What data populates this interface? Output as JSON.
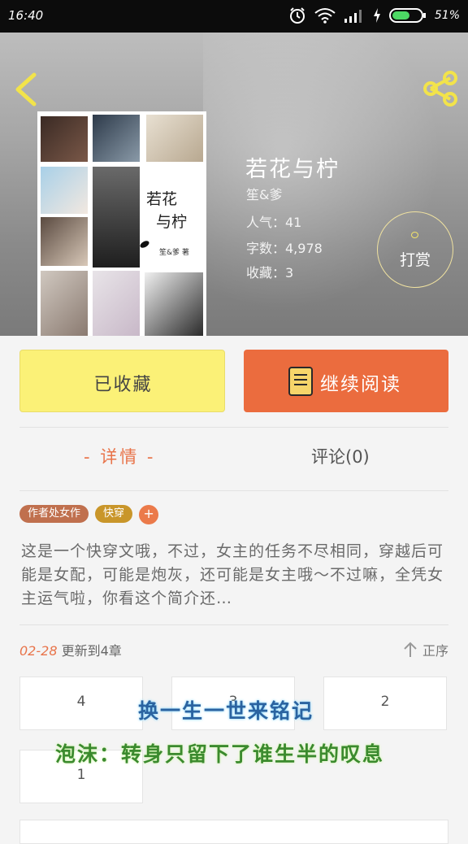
{
  "status_bar": {
    "time": "16:40",
    "battery_percent": "51%",
    "icons": [
      "alarm-icon",
      "wifi-icon",
      "signal-icon",
      "charging-icon",
      "battery-icon"
    ]
  },
  "header": {
    "back_icon": "chevron-left-icon",
    "share_icon": "share-icon"
  },
  "cover": {
    "title_line1": "若花",
    "title_line2": "与柠",
    "author": "笙&爹 著"
  },
  "book": {
    "title": "若花与柠",
    "author": "笙&爹",
    "popularity": "人气：41",
    "word_count": "字数：4,978",
    "favorites": "收藏：3"
  },
  "reward": {
    "label": "打赏"
  },
  "actions": {
    "favorited_label": "已收藏",
    "continue_label": "继续阅读",
    "continue_icon": "book-icon"
  },
  "tabs": {
    "details": "- 详情 -",
    "comments": "评论(0)"
  },
  "tags": [
    {
      "label": "作者处女作",
      "color": "#c0704e"
    },
    {
      "label": "快穿",
      "color": "#c9962a"
    }
  ],
  "tag_add_label": "+",
  "intro": "这是一个快穿文哦，不过，女主的任务不尽相同，穿越后可能是女配，可能是炮灰，还可能是女主哦～不过嘛，全凭女主运气啦，你看这个简介还…",
  "update": {
    "date": "02-28",
    "text": "更新到4章"
  },
  "sort": {
    "label": "正序",
    "icon": "arrow-up-icon"
  },
  "chapters": [
    "4",
    "3",
    "2",
    "1"
  ],
  "overlay": {
    "line1": "换一生一世来铭记",
    "line2": "泡沫：转身只留下了谁生半的叹息"
  },
  "colors": {
    "accent": "#eb6c3e",
    "fav_yellow": "#fbf177"
  }
}
